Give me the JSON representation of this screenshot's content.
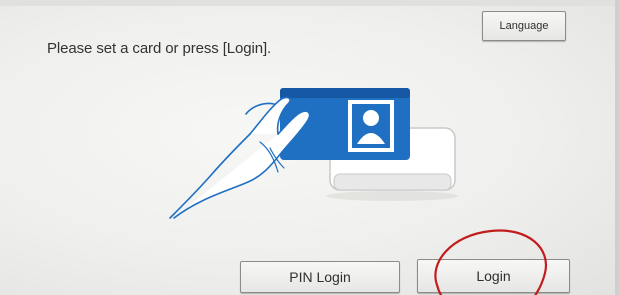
{
  "prompt": {
    "text": "Please set a card or press [Login]."
  },
  "header": {
    "language_label": "Language"
  },
  "footer": {
    "pin_login_label": "PIN Login",
    "login_label": "Login"
  },
  "illustration": {
    "name": "card-reader-illustration"
  },
  "colors": {
    "card_blue": "#1f6fc2",
    "card_blue_dark": "#1658a3",
    "annotation_red": "#c21d1d",
    "background": "#efefed"
  }
}
